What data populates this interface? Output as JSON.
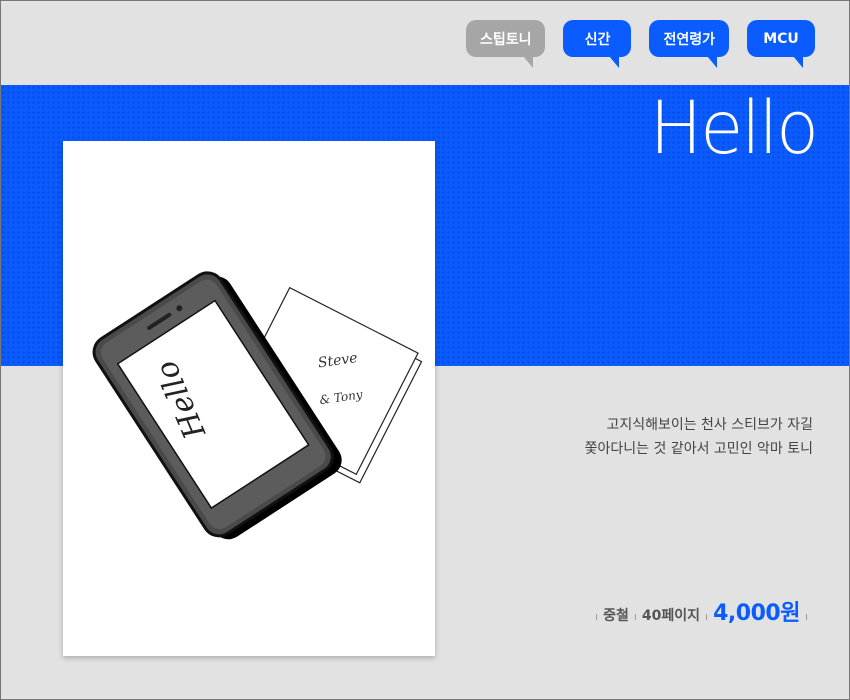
{
  "tags": [
    {
      "label": "스팁토니",
      "style": "muted"
    },
    {
      "label": "신간",
      "style": "primary"
    },
    {
      "label": "전연령가",
      "style": "primary"
    },
    {
      "label": "MCU",
      "style": "primary"
    }
  ],
  "hero": {
    "title": "Hello"
  },
  "cover": {
    "phone_text": "Hello",
    "card_text_1": "Steve",
    "card_text_2": "& Tony"
  },
  "description": {
    "line1": "고지식해보이는 천사 스티브가 자길",
    "line2": "쫓아다니는 것 같아서 고민인 악마 토니"
  },
  "meta": {
    "binding": "중철",
    "pages": "40페이지",
    "price": "4,000원"
  },
  "colors": {
    "accent": "#0a5cff",
    "muted_tag": "#a6a6a6",
    "background": "#e2e2e2"
  }
}
